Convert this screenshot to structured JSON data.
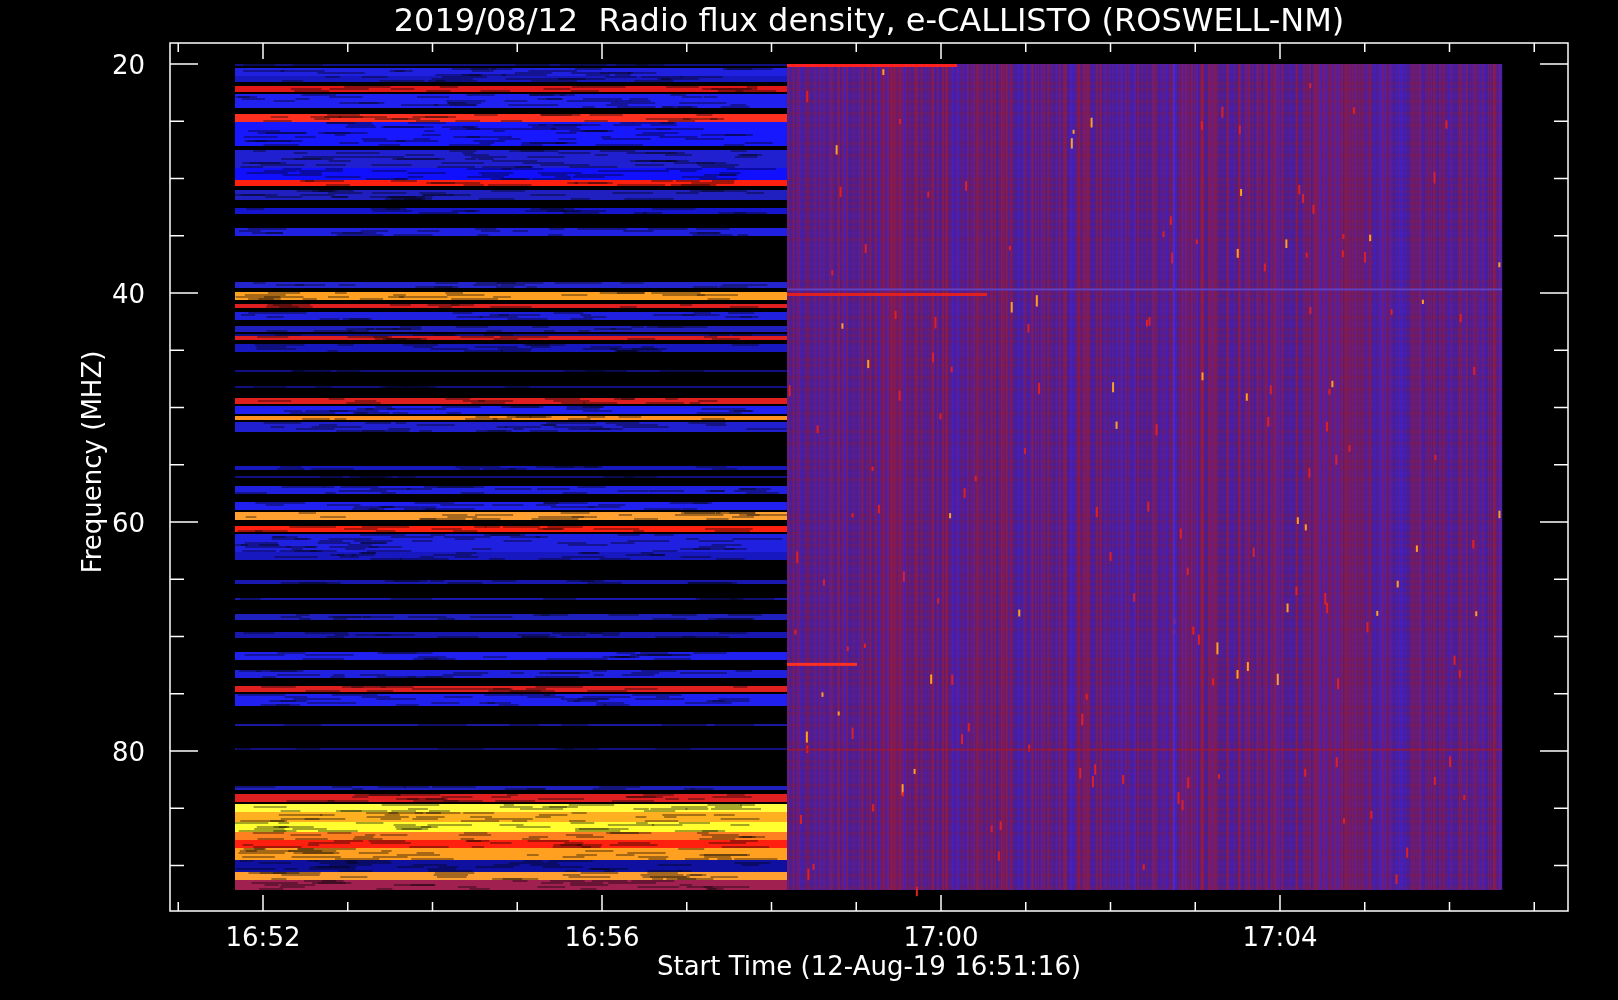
{
  "title": "2019/08/12  Radio flux density, e-CALLISTO (ROSWELL-NM)",
  "y_axis": {
    "label": "Frequency (MHZ)",
    "ticks": [
      "20",
      "40",
      "60",
      "80"
    ]
  },
  "x_axis": {
    "label": "Start Time (12-Aug-19 16:51:16)",
    "ticks": [
      "16:52",
      "16:56",
      "17:00",
      "17:04"
    ]
  }
}
